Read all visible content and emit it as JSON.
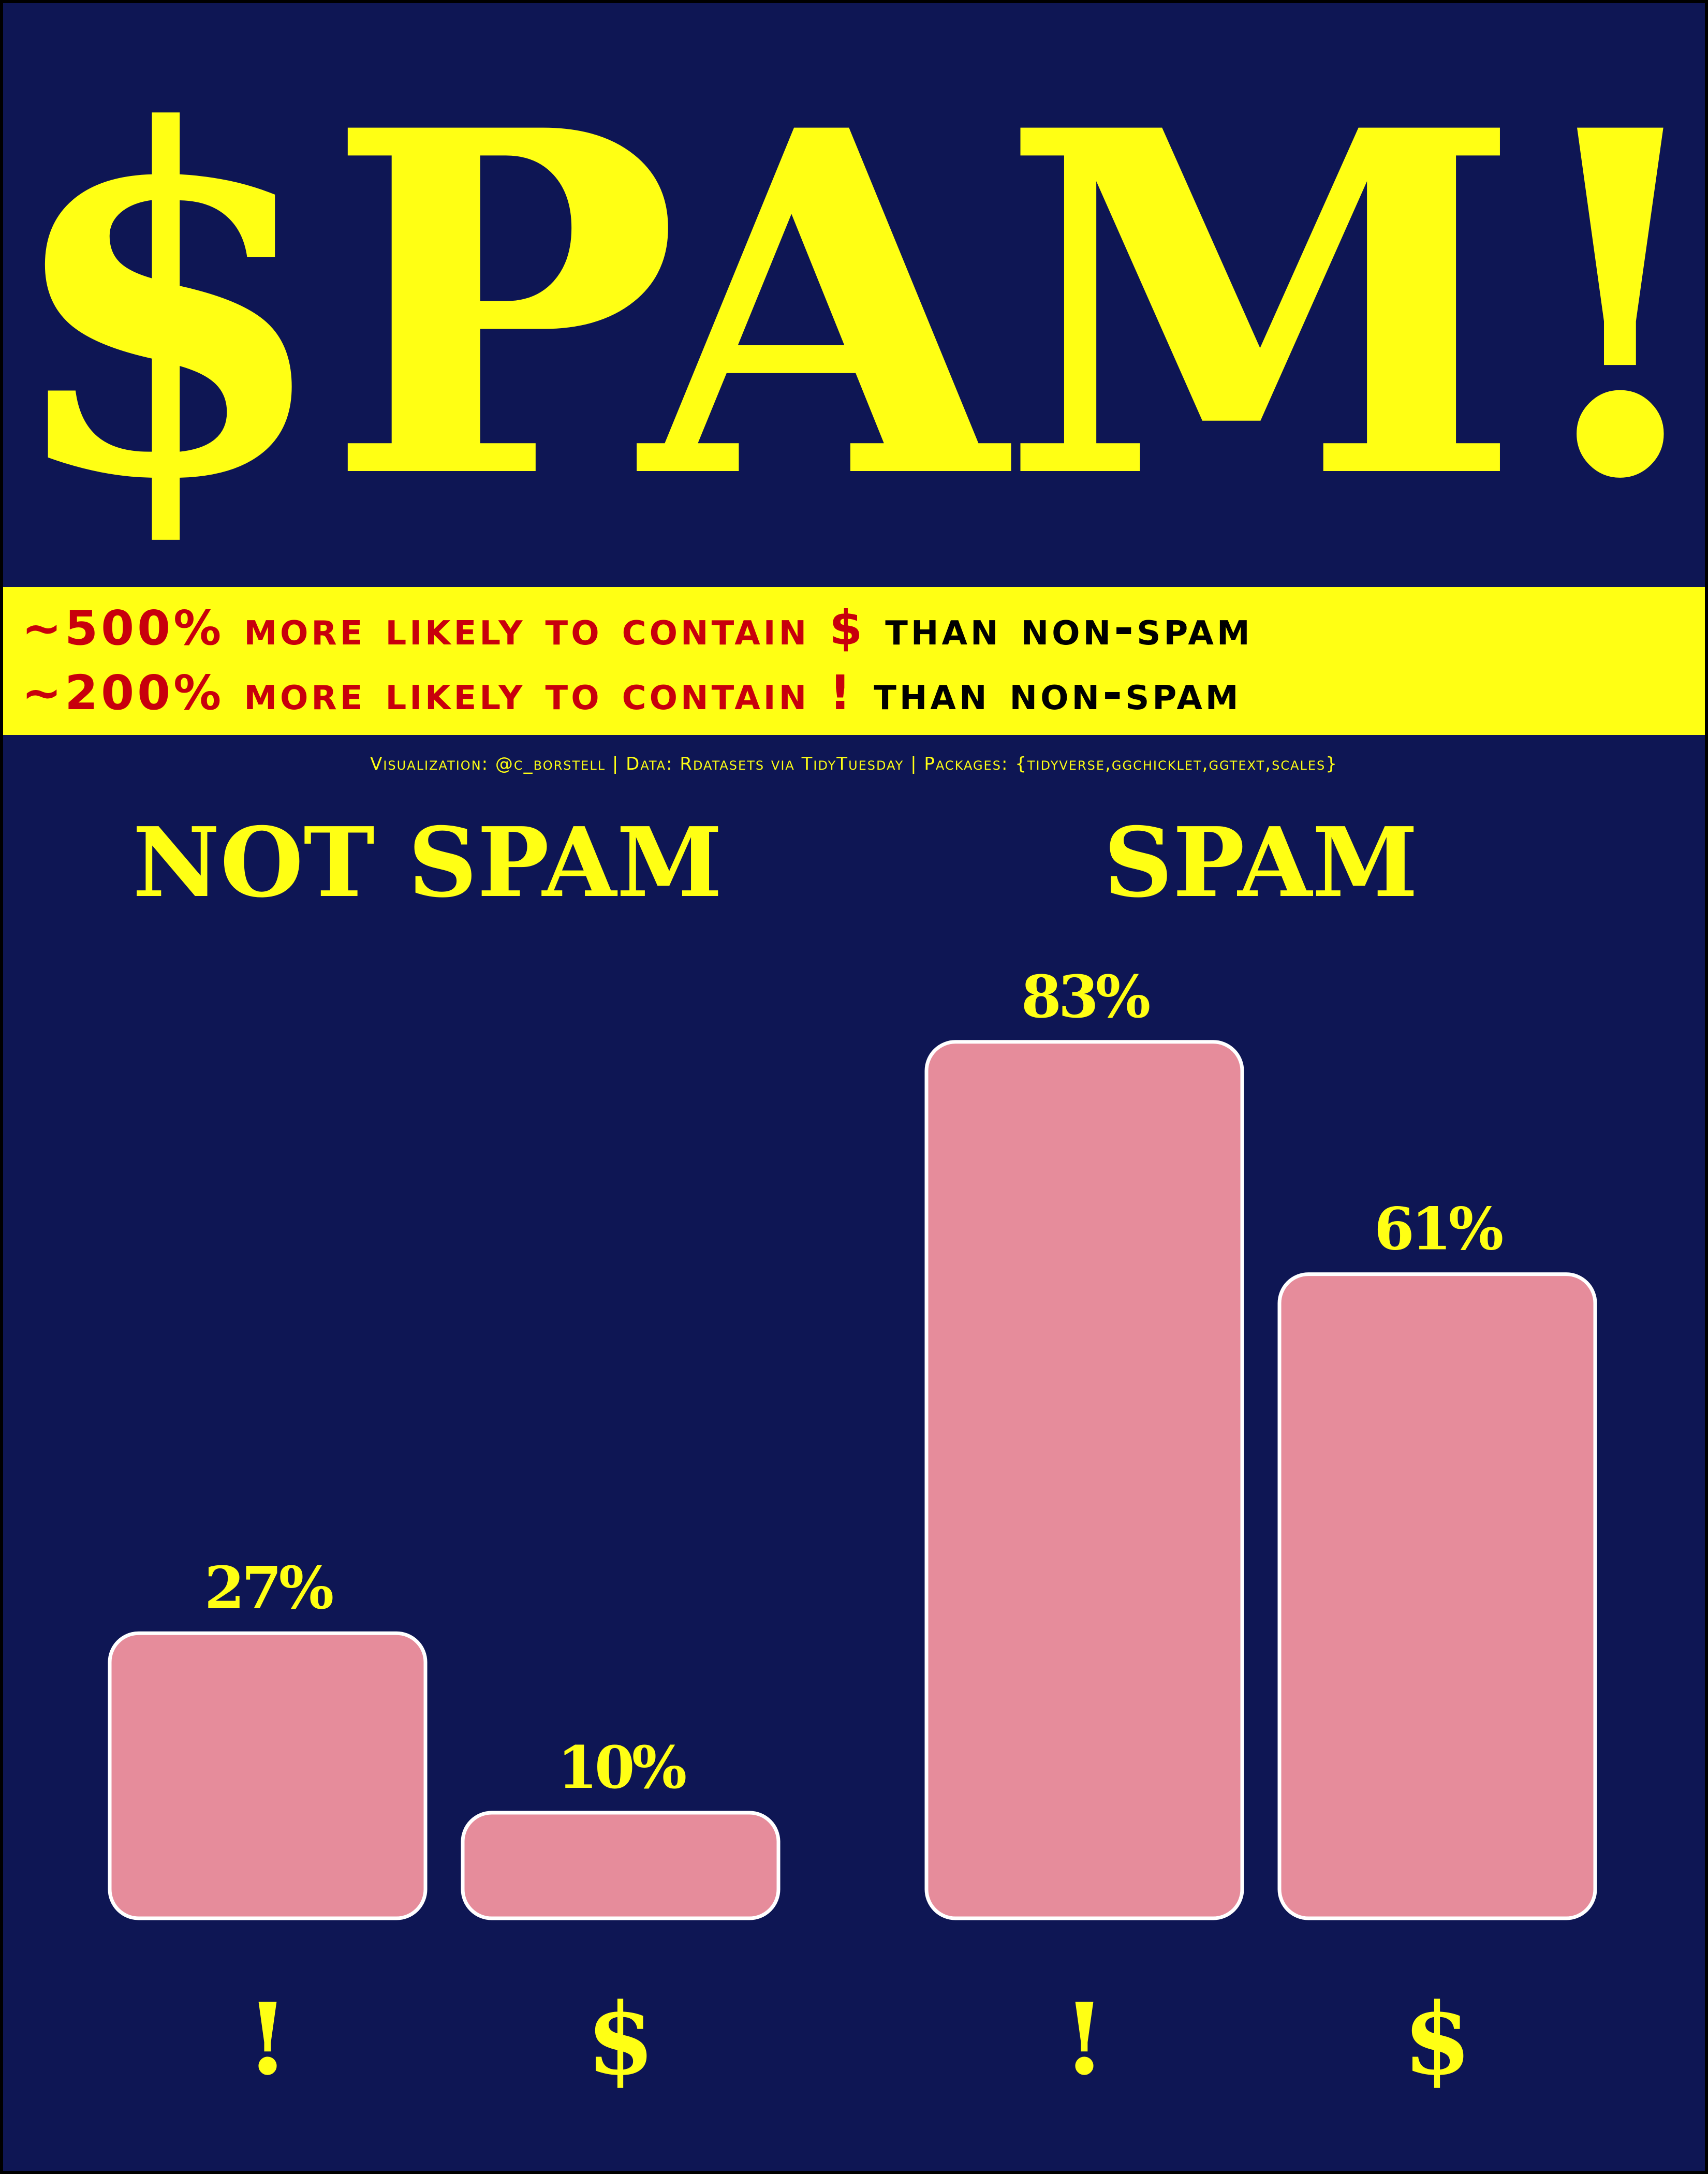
{
  "title": "$PAM!",
  "banner": {
    "line1": {
      "stat": "~500% more likely to contain $",
      "rest": "than non-spam"
    },
    "line2": {
      "stat": "~200% more likely to contain !",
      "rest": "than non-spam"
    }
  },
  "caption": "Visualization: @c_borstell | Data: Rdatasets via TidyTuesday | Packages: {tidyverse,ggchicklet,ggtext,scales}",
  "colors": {
    "background": "#0e1654",
    "accent": "#ffff14",
    "banner_red": "#c8000c",
    "bar_fill": "#e68c9b",
    "bar_outline": "#ffffff"
  },
  "chart_data": {
    "type": "bar",
    "facets": [
      "NOT SPAM",
      "SPAM"
    ],
    "categories": [
      "!",
      "$"
    ],
    "series": [
      {
        "facet": "NOT SPAM",
        "values": [
          27,
          10
        ],
        "labels": [
          "27%",
          "10%"
        ]
      },
      {
        "facet": "SPAM",
        "values": [
          83,
          61
        ],
        "labels": [
          "83%",
          "61%"
        ]
      }
    ],
    "ylim": [
      0,
      100
    ],
    "grid": false,
    "legend": "none",
    "bar_style": "rounded"
  }
}
